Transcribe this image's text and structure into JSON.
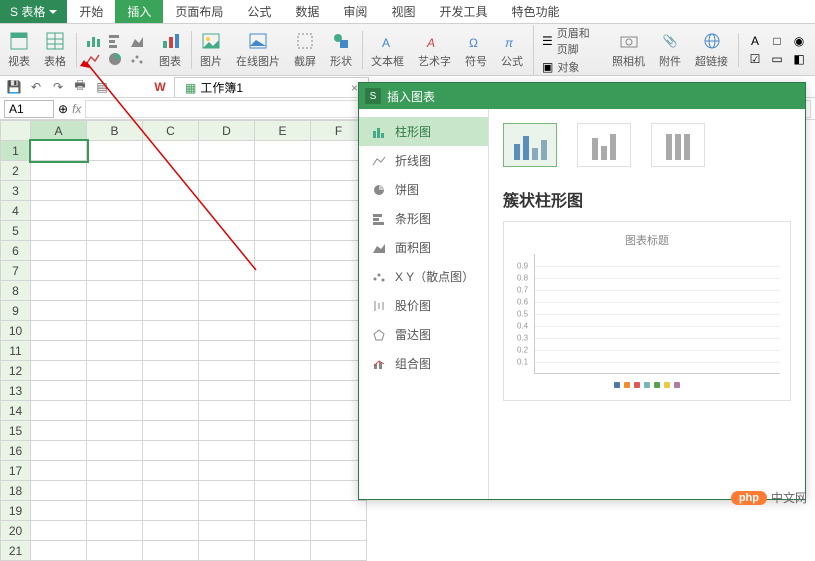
{
  "app_title": "S 表格",
  "menu": {
    "tabs": [
      "开始",
      "插入",
      "页面布局",
      "公式",
      "数据",
      "审阅",
      "视图",
      "开发工具",
      "特色功能"
    ],
    "active": 1
  },
  "ribbon": {
    "labels": {
      "pivot": "视表",
      "table": "表格",
      "chart": "图表",
      "pic": "图片",
      "onlinepic": "在线图片",
      "screenshot": "截屏",
      "shape": "形状",
      "textbox": "文本框",
      "wordart": "艺术字",
      "symbol": "符号",
      "formula": "公式",
      "header": "页眉和页脚",
      "object": "对象",
      "camera": "照相机",
      "attach": "附件",
      "link": "超链接"
    }
  },
  "doc": {
    "name": "工作簿1"
  },
  "cell": {
    "ref": "A1"
  },
  "columns": [
    "A",
    "B",
    "C",
    "D",
    "E",
    "F"
  ],
  "rows": 21,
  "dialog": {
    "title": "插入图表",
    "categories": [
      "柱形图",
      "折线图",
      "饼图",
      "条形图",
      "面积图",
      "X Y（散点图）",
      "股价图",
      "雷达图",
      "组合图"
    ],
    "active": 0,
    "selected_name": "簇状柱形图",
    "preview_title": "图表标题",
    "yticks": [
      "0.9",
      "0.8",
      "0.7",
      "0.6",
      "0.5",
      "0.4",
      "0.3",
      "0.2",
      "0.1"
    ],
    "legend_colors": [
      "#4e79a7",
      "#f28e2b",
      "#e15759",
      "#76b7b2",
      "#59a14f",
      "#edc948",
      "#b07aa1"
    ]
  },
  "watermark": {
    "badge": "php",
    "text": "中文网"
  }
}
